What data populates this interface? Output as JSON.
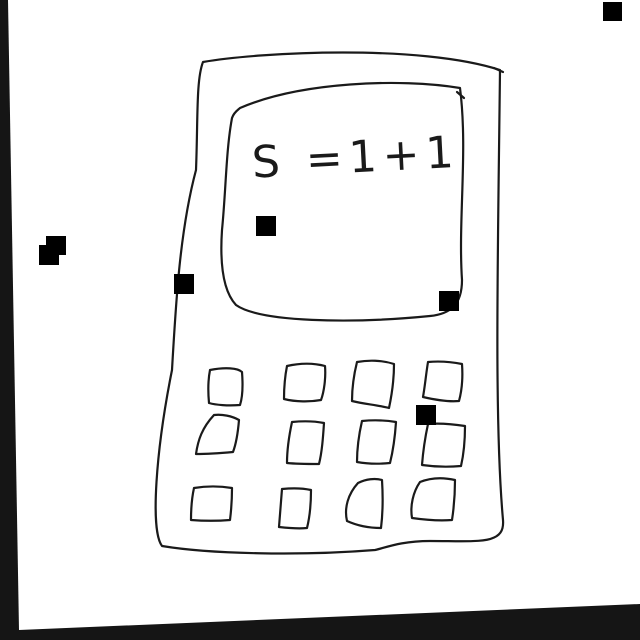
{
  "screen_text": "S =1+1",
  "colors": {
    "background_border": "#151515",
    "paper": "#ffffff",
    "ink": "#1a1a1a",
    "marker": "#000000"
  }
}
